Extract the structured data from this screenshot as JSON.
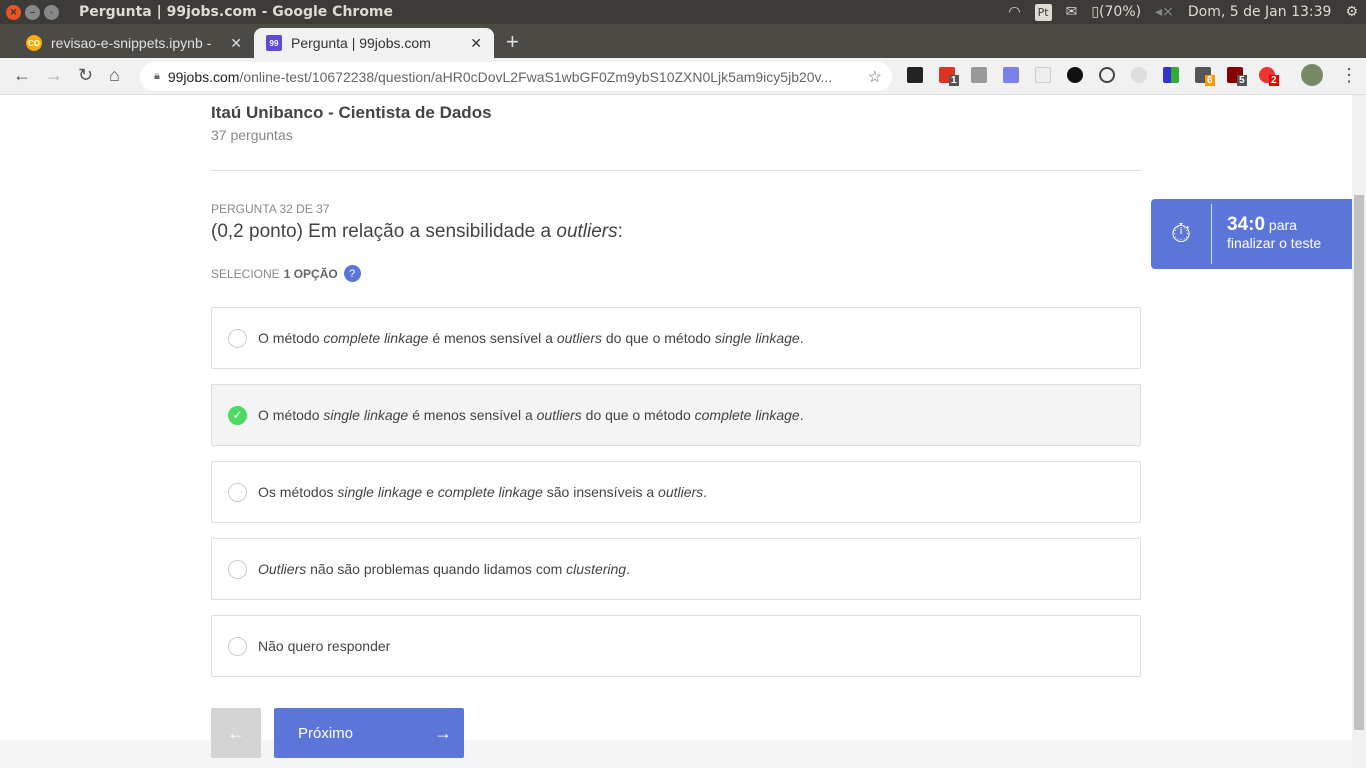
{
  "window": {
    "title": "Pergunta | 99jobs.com - Google Chrome"
  },
  "tray": {
    "lang": "Pt",
    "battery": "(70%)",
    "datetime": "Dom,  5 de Jan 13:39"
  },
  "tabs": [
    {
      "label": "revisao-e-snippets.ipynb -",
      "favicon": "CO"
    },
    {
      "label": "Pergunta | 99jobs.com",
      "favicon": "99"
    }
  ],
  "address": {
    "host": "99jobs.com",
    "path": "/online-test/10672238/question/aHR0cDovL2FwaS1wbGF0Zm9ybS10ZXN0Ljk5am9icy5jb20v..."
  },
  "extensions": {
    "badges": [
      "1",
      "6",
      "5",
      "2"
    ]
  },
  "test": {
    "title": "Itaú Unibanco - Cientista de Dados",
    "count": "37 perguntas"
  },
  "question": {
    "number": "PERGUNTA 32 DE 37",
    "text_prefix": "(0,2 ponto) Em relação a sensibilidade a ",
    "text_italic": "outliers",
    "text_suffix": ":",
    "select_label": "SELECIONE",
    "select_bold": "1 OPÇÃO",
    "help": "?"
  },
  "options": [
    {
      "selected": false,
      "segments": [
        {
          "t": "O método "
        },
        {
          "t": "complete linkage",
          "i": true
        },
        {
          "t": " é menos sensível a "
        },
        {
          "t": "outliers",
          "i": true
        },
        {
          "t": " do que o método "
        },
        {
          "t": "single linkage",
          "i": true
        },
        {
          "t": "."
        }
      ]
    },
    {
      "selected": true,
      "segments": [
        {
          "t": "O método "
        },
        {
          "t": "single linkage",
          "i": true
        },
        {
          "t": " é menos sensível a "
        },
        {
          "t": "outliers",
          "i": true
        },
        {
          "t": " do que o método "
        },
        {
          "t": "complete linkage",
          "i": true
        },
        {
          "t": "."
        }
      ]
    },
    {
      "selected": false,
      "segments": [
        {
          "t": "Os métodos "
        },
        {
          "t": "single linkage",
          "i": true
        },
        {
          "t": " e "
        },
        {
          "t": "complete linkage",
          "i": true
        },
        {
          "t": " são insensíveis a "
        },
        {
          "t": "outliers",
          "i": true
        },
        {
          "t": "."
        }
      ]
    },
    {
      "selected": false,
      "segments": [
        {
          "t": "Outliers",
          "i": true
        },
        {
          "t": " não são problemas quando lidamos com "
        },
        {
          "t": "clustering",
          "i": true
        },
        {
          "t": "."
        }
      ]
    },
    {
      "selected": false,
      "segments": [
        {
          "t": "Não quero responder"
        }
      ]
    }
  ],
  "buttons": {
    "next": "Próximo"
  },
  "timer": {
    "time": "34:0",
    "suffix": " para",
    "line2": "finalizar o teste"
  },
  "colors": {
    "accent": "#5b76d8",
    "selected": "#4cd964"
  }
}
